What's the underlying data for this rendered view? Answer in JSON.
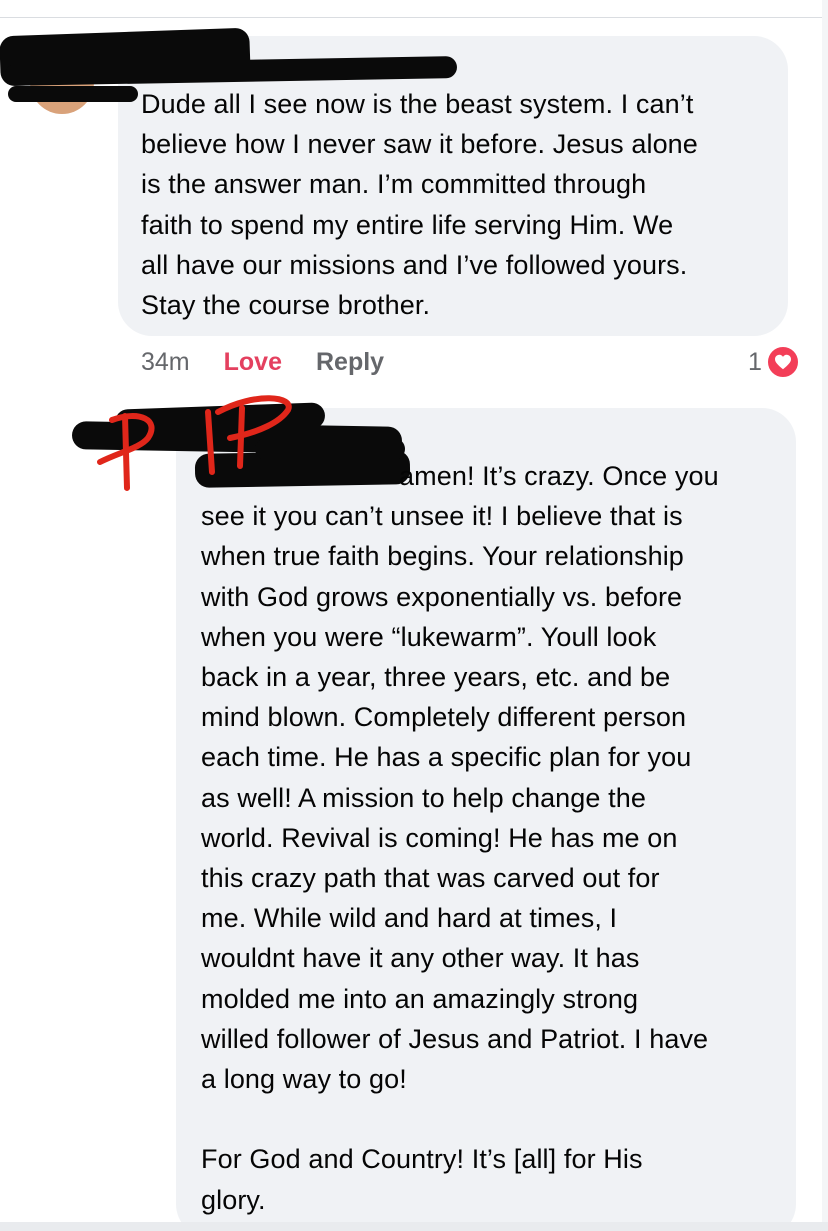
{
  "comments": [
    {
      "text": "Dude all I see now is the beast system. I can’t\nbelieve how I never saw it before. Jesus alone\nis the answer man. I’m committed through\nfaith to spend my entire life serving Him. We\nall have our missions and I’ve followed yours.\nStay the course brother.",
      "time": "34m",
      "love_label": "Love",
      "reply_label": "Reply",
      "reaction_count": "1",
      "reaction_icon": "heart-icon"
    },
    {
      "annotation": "PIP",
      "first_line": "amen! It’s crazy. Once you",
      "text": "see it you can’t unsee it! I believe that is\nwhen true faith begins. Your relationship\nwith God grows exponentially vs. before\nwhen you were “lukewarm”. Youll look\nback in a year, three years, etc. and be\nmind blown. Completely different person\neach time. He has a specific plan for you\nas well! A mission to help change the\nworld. Revival is coming! He has me on\nthis crazy path that was carved out for\nme. While wild and hard at times, I\nwouldnt have it any other way. It has\nmolded me into an amazingly strong\nwilled follower of Jesus and Patriot. I have\na long way to go!\n\nFor God and Country! It’s [all] for His\nglory."
    }
  ],
  "colors": {
    "bubble": "#f0f2f5",
    "love": "#e4405f",
    "heart": "#f33e58",
    "annotation": "#e0261a"
  }
}
